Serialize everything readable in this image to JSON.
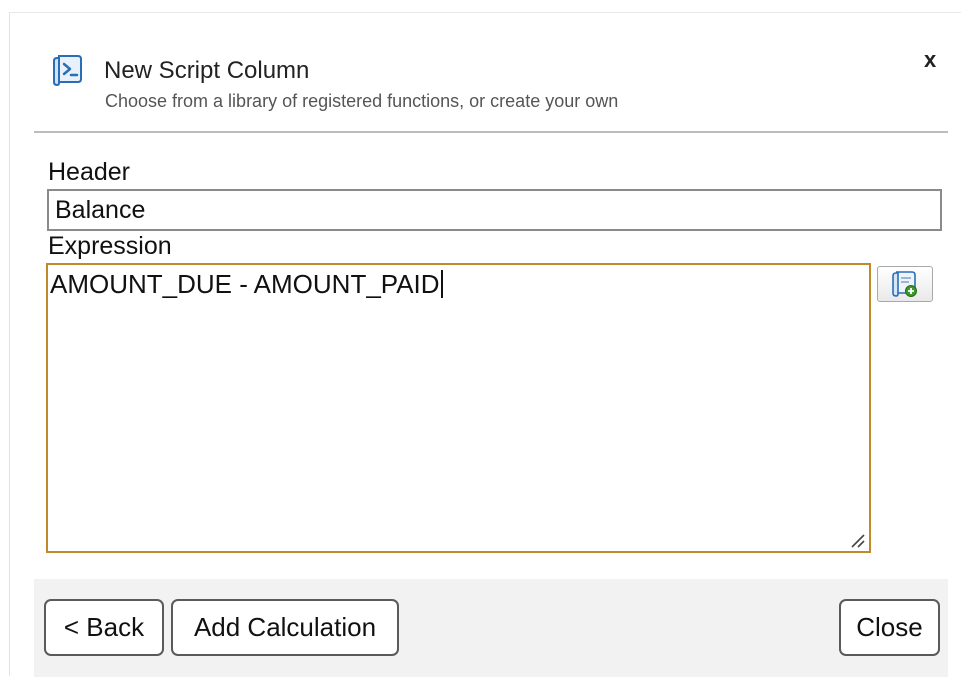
{
  "dialog": {
    "title": "New Script Column",
    "subtitle": "Choose from a library of registered functions, or create your own",
    "close_glyph": "x",
    "header_icon": "script-icon"
  },
  "form": {
    "header_label": "Header",
    "header_value": "Balance",
    "expression_label": "Expression",
    "expression_value": "AMOUNT_DUE - AMOUNT_PAID",
    "function_library_icon": "script-add-icon"
  },
  "footer": {
    "back_label": "< Back",
    "add_calculation_label": "Add Calculation",
    "close_label": "Close"
  },
  "colors": {
    "expression_border": "#c08a2a",
    "footer_background": "#f2f2f2",
    "icon_blue": "#2a6fb5",
    "icon_green": "#3a9a2a"
  }
}
